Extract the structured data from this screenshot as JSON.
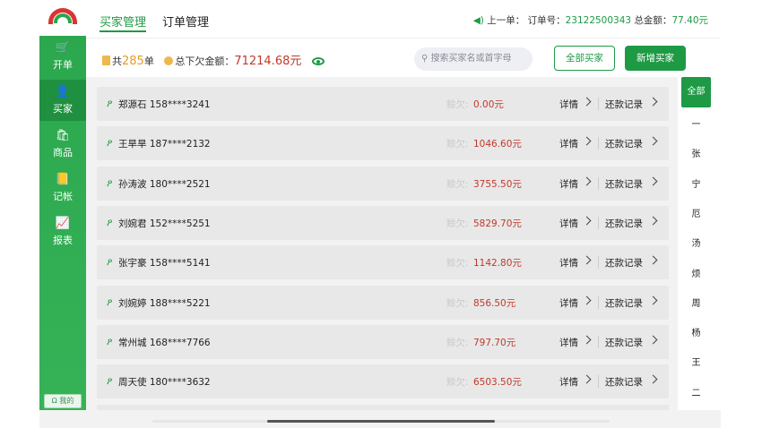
{
  "sidebar": {
    "items": [
      {
        "label": "开单",
        "icon": "cart-icon",
        "glyph": "🛒"
      },
      {
        "label": "买家",
        "icon": "person-icon",
        "glyph": "👤"
      },
      {
        "label": "商品",
        "icon": "bag-icon",
        "glyph": "🛍"
      },
      {
        "label": "记帐",
        "icon": "ledger-icon",
        "glyph": "📒"
      },
      {
        "label": "报表",
        "icon": "chart-icon",
        "glyph": "📈"
      }
    ],
    "active_index": 1,
    "me_label": "我的"
  },
  "tabs": [
    {
      "label": "买家管理",
      "active": true
    },
    {
      "label": "订单管理",
      "active": false
    }
  ],
  "last_order": {
    "prefix": "上一单：",
    "order_label": "订单号：",
    "order_no": "23122500343",
    "total_label": "总金额：",
    "total": "77.40元"
  },
  "summary": {
    "count_prefix": "共",
    "count": "285",
    "count_suffix": "单",
    "owe_label": "总下欠金额：",
    "owe_total": "71214.68元"
  },
  "search": {
    "placeholder": "搜索买家名或首字母"
  },
  "buttons": {
    "all_buyers": "全部买家",
    "new_buyer": "新增买家"
  },
  "row_labels": {
    "owe": "赊欠:",
    "detail": "详情",
    "repay": "还款记录"
  },
  "buyers": [
    {
      "name": "郑源石",
      "phone": "158****3241",
      "owe": "0.00元"
    },
    {
      "name": "王旱旱",
      "phone": "187****2132",
      "owe": "1046.60元"
    },
    {
      "name": "孙涛波",
      "phone": "180****2521",
      "owe": "3755.50元"
    },
    {
      "name": "刘婉君",
      "phone": "152****5251",
      "owe": "5829.70元"
    },
    {
      "name": "张宇豪",
      "phone": "158****5141",
      "owe": "1142.80元"
    },
    {
      "name": "刘婉婷",
      "phone": "188****5221",
      "owe": "856.50元"
    },
    {
      "name": "常州城",
      "phone": "168****7766",
      "owe": "797.70元"
    },
    {
      "name": "周天使",
      "phone": "180****3632",
      "owe": "6503.50元"
    }
  ],
  "index": {
    "all": "全部",
    "letters": [
      "一",
      "张",
      "宁",
      "厄",
      "汤",
      "烦",
      "周",
      "杨",
      "王",
      "二"
    ]
  },
  "colors": {
    "brand": "#1e9a45",
    "owe": "#c0392b",
    "highlight": "#e89a22"
  }
}
